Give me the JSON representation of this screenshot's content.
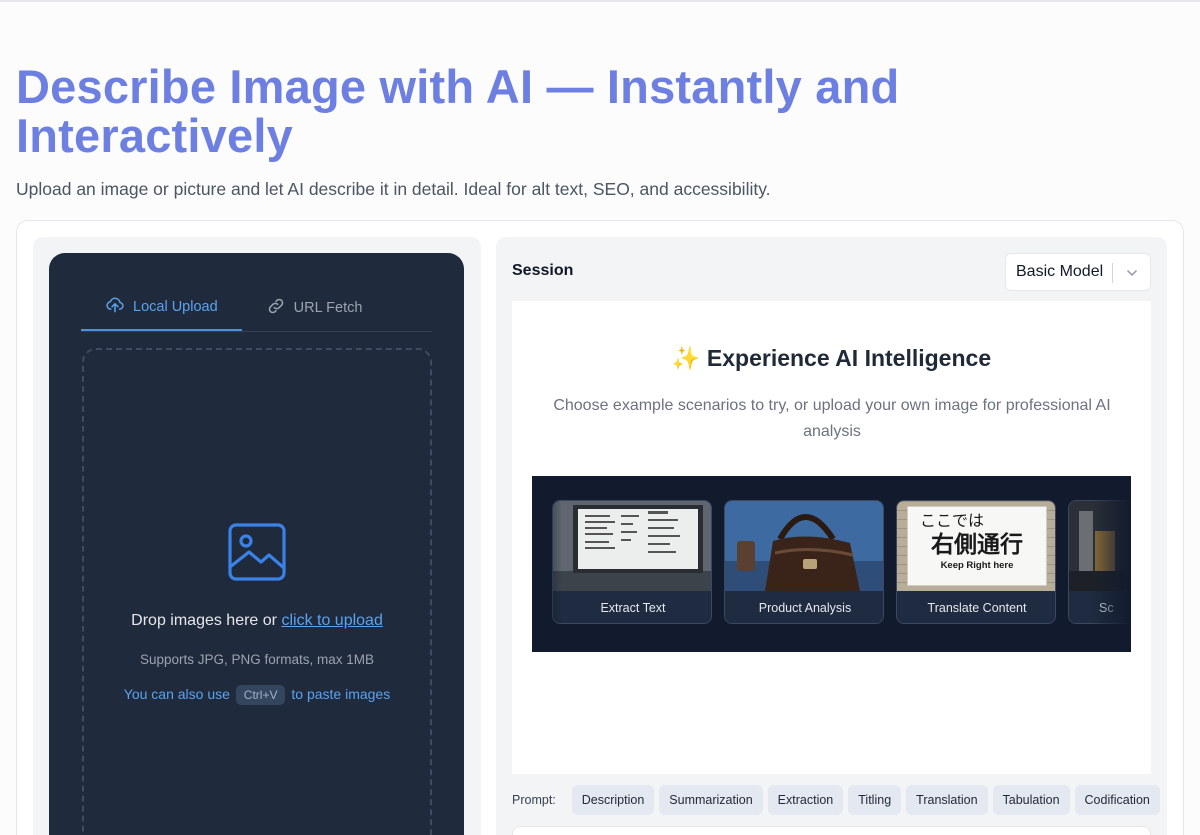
{
  "hero": {
    "title": "Describe Image with AI — Instantly and Interactively",
    "subtitle": "Upload an image or picture and let AI describe it in detail. Ideal for alt text, SEO, and accessibility."
  },
  "upload": {
    "tabs": [
      {
        "label": "Local Upload",
        "icon": "cloud-upload-icon",
        "active": true
      },
      {
        "label": "URL Fetch",
        "icon": "link-icon",
        "active": false
      }
    ],
    "drop_text": "Drop images here or",
    "drop_link": "click to upload",
    "formats": "Supports JPG, PNG formats, max 1MB",
    "paste_prefix": "You can also use",
    "paste_key": "Ctrl+V",
    "paste_suffix": "to paste images"
  },
  "session": {
    "label": "Session",
    "model": "Basic Model"
  },
  "experience": {
    "icon": "✨",
    "title": "Experience AI Intelligence",
    "description": "Choose example scenarios to try, or upload your own image for professional AI analysis"
  },
  "examples": [
    {
      "label": "Extract Text"
    },
    {
      "label": "Product Analysis"
    },
    {
      "label": "Translate Content",
      "sign_line1": "ここでは",
      "sign_line2": "右側通行",
      "sign_line3": "Keep Right here"
    },
    {
      "label": "Sc"
    }
  ],
  "prompts": {
    "label": "Prompt:",
    "chips": [
      "Description",
      "Summarization",
      "Extraction",
      "Titling",
      "Translation",
      "Tabulation",
      "Codification"
    ]
  },
  "colors": {
    "accent": "#6d7fe0",
    "link": "#5aa3ee",
    "panel": "#1f2a3d"
  }
}
